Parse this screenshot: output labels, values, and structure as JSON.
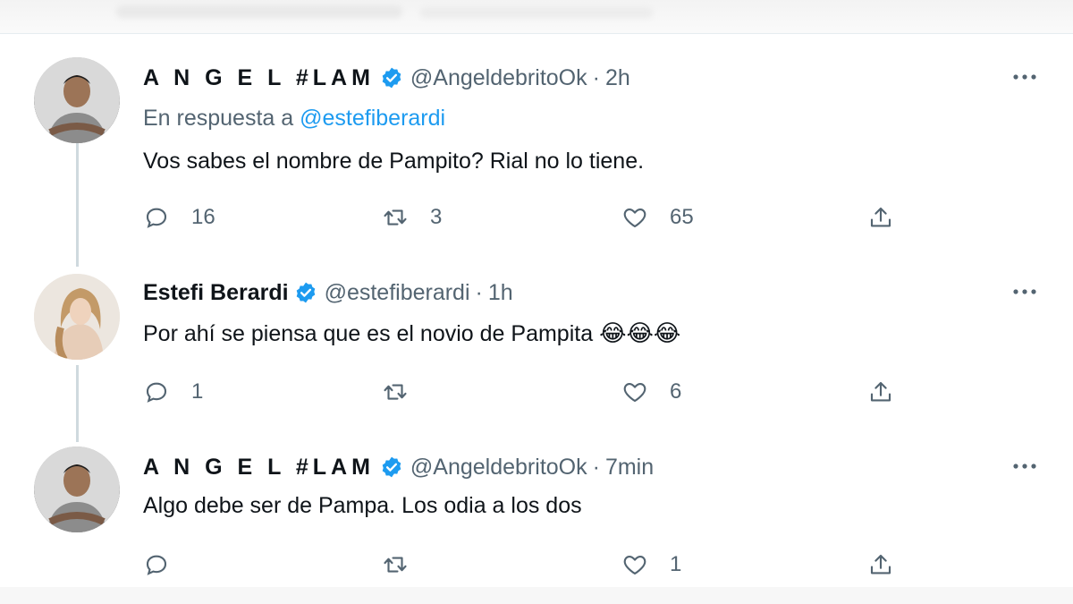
{
  "tweets": [
    {
      "author": "A N G E L #LAM",
      "handle": "@AngeldebritoOk",
      "separator": "·",
      "time": "2h",
      "reply_prefix": "En respuesta a",
      "reply_to": "@estefiberardi",
      "text": "Vos sabes el nombre de Pampito? Rial no lo tiene.",
      "emojis": "",
      "replies": "16",
      "retweets": "3",
      "likes": "65"
    },
    {
      "author": "Estefi Berardi",
      "handle": "@estefiberardi",
      "separator": "·",
      "time": "1h",
      "text": "Por ahí se piensa que es el novio de Pampita",
      "emojis": "😂😂😂",
      "replies": "1",
      "retweets": "",
      "likes": "6"
    },
    {
      "author": "A N G E L #LAM",
      "handle": "@AngeldebritoOk",
      "separator": "·",
      "time": "7min",
      "text": "Algo debe ser de Pampa. Los odia a los dos",
      "emojis": "",
      "replies": "",
      "retweets": "",
      "likes": "1"
    }
  ],
  "icons": {
    "verified": "verified-badge-icon",
    "more": "more-options-icon",
    "reply": "reply-icon",
    "retweet": "retweet-icon",
    "like": "like-icon",
    "share": "share-icon"
  },
  "colors": {
    "verified": "#1d9bf0",
    "link": "#1d9bf0",
    "secondary_text": "#536471",
    "thread_line": "#cfd9de"
  }
}
